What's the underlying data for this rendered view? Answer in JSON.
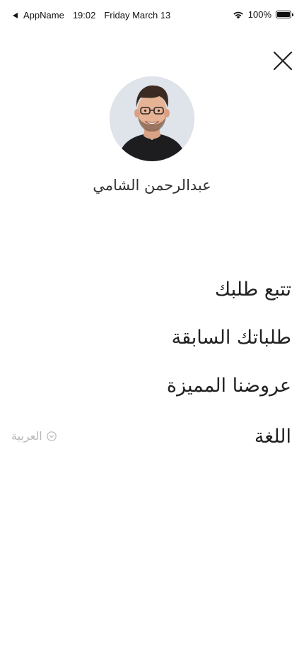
{
  "status_bar": {
    "app_name": "AppName",
    "time": "19:02",
    "date": "Friday March 13",
    "battery": "100%",
    "battery_level": 1.0
  },
  "header": {
    "close_icon": "close-icon"
  },
  "profile": {
    "avatar_icon": "user-avatar",
    "name": "عبدالرحمن الشامي"
  },
  "menu": {
    "items": [
      {
        "label": "تتبع طلبك"
      },
      {
        "label": "طلباتك السابقة"
      },
      {
        "label": "عروضنا المميزة"
      }
    ],
    "language": {
      "label": "اللغة",
      "selected": "العربية"
    }
  },
  "colors": {
    "text": "#222222",
    "muted": "#b8b8b8",
    "avatar_bg": "#dfe3ea"
  }
}
